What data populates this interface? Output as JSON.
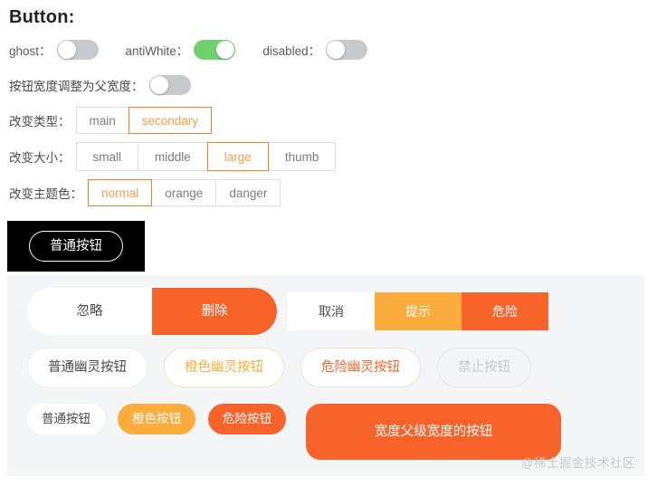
{
  "page": {
    "title": "Button:"
  },
  "switches": [
    {
      "label": "ghost：",
      "state": "off",
      "on_color": "#6ed06e",
      "off_color": "#c8c9cc"
    },
    {
      "label": "antiWhite：",
      "state": "on",
      "on_color": "#6ed06e",
      "off_color": "#c8c9cc"
    },
    {
      "label": "disabled：",
      "state": "off",
      "on_color": "#6ed06e",
      "off_color": "#c8c9cc"
    }
  ],
  "parent_width_switch": {
    "label": "按钮宽度调整为父宽度：",
    "state": "off"
  },
  "radio_groups": [
    {
      "name": "type",
      "label": "改变类型：",
      "options": [
        "main",
        "secondary"
      ],
      "selected": "secondary"
    },
    {
      "name": "size",
      "label": "改变大小：",
      "options": [
        "small",
        "middle",
        "large",
        "thumb"
      ],
      "selected": "large"
    },
    {
      "name": "theme",
      "label": "改变主题色：",
      "options": [
        "normal",
        "orange",
        "danger"
      ],
      "selected": "normal"
    }
  ],
  "black_preview": {
    "button_label": "普通按钮"
  },
  "panel": {
    "background": "#f4f5f7",
    "group_round": [
      {
        "label": "忽略",
        "style": "white"
      },
      {
        "label": "删除",
        "style": "danger"
      }
    ],
    "group_square": [
      {
        "label": "取消",
        "style": "white"
      },
      {
        "label": "提示",
        "style": "orange"
      },
      {
        "label": "危险",
        "style": "danger"
      }
    ],
    "ghost_buttons": [
      {
        "label": "普通幽灵按钮",
        "style": "normal"
      },
      {
        "label": "橙色幽灵按钮",
        "style": "orange"
      },
      {
        "label": "危险幽灵按钮",
        "style": "danger"
      },
      {
        "label": "禁止按钮",
        "style": "disabled"
      }
    ],
    "pill_buttons": [
      {
        "label": "普通按钮",
        "style": "white"
      },
      {
        "label": "橙色按钮",
        "style": "orange"
      },
      {
        "label": "危险按钮",
        "style": "danger"
      }
    ],
    "wide_button": {
      "label": "宽度父级宽度的按钮"
    }
  },
  "watermark": "@稀土掘金技术社区",
  "colors": {
    "accent_orange": "#f57e20",
    "amber": "#fbad3c",
    "danger": "#f8632a",
    "switch_on": "#6ed06e",
    "panel_bg": "#f4f5f7"
  }
}
